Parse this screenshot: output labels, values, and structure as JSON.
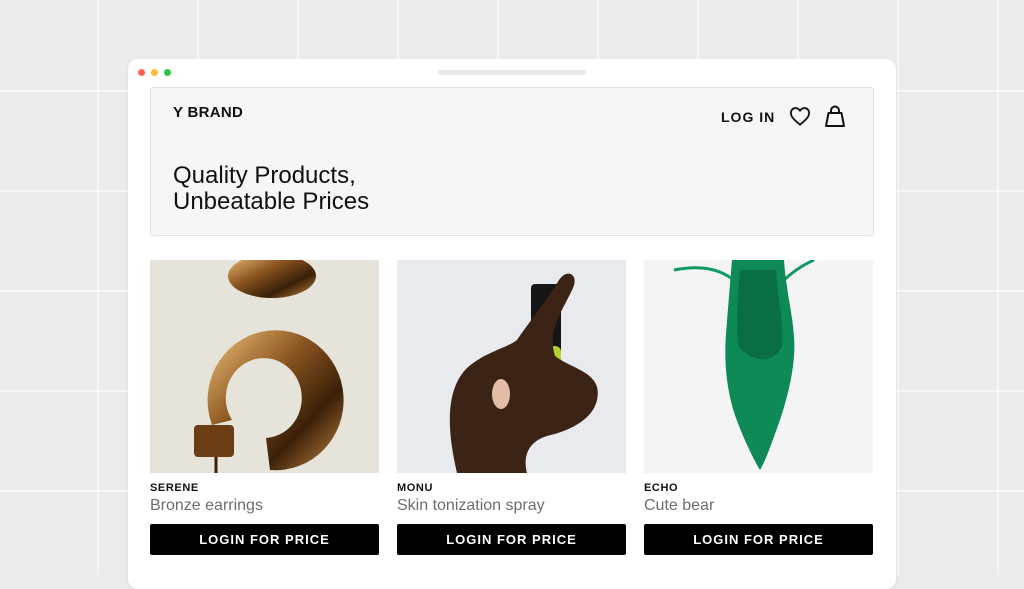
{
  "header": {
    "brand": "Y BRAND",
    "login_label": "LOG IN",
    "headline_line1": "Quality Products,",
    "headline_line2": "Unbeatable Prices"
  },
  "icons": {
    "wishlist": "heart-icon",
    "cart": "shopping-bag-icon"
  },
  "window_dots": [
    "#ff5f57",
    "#febc2e",
    "#28c840"
  ],
  "products": [
    {
      "brand": "SERENE",
      "name": "Bronze earrings",
      "button": "LOGIN FOR PRICE"
    },
    {
      "brand": "MONU",
      "name": "Skin tonization spray",
      "button": "LOGIN FOR PRICE"
    },
    {
      "brand": "ECHO",
      "name": "Cute bear",
      "button": "LOGIN FOR PRICE"
    }
  ]
}
